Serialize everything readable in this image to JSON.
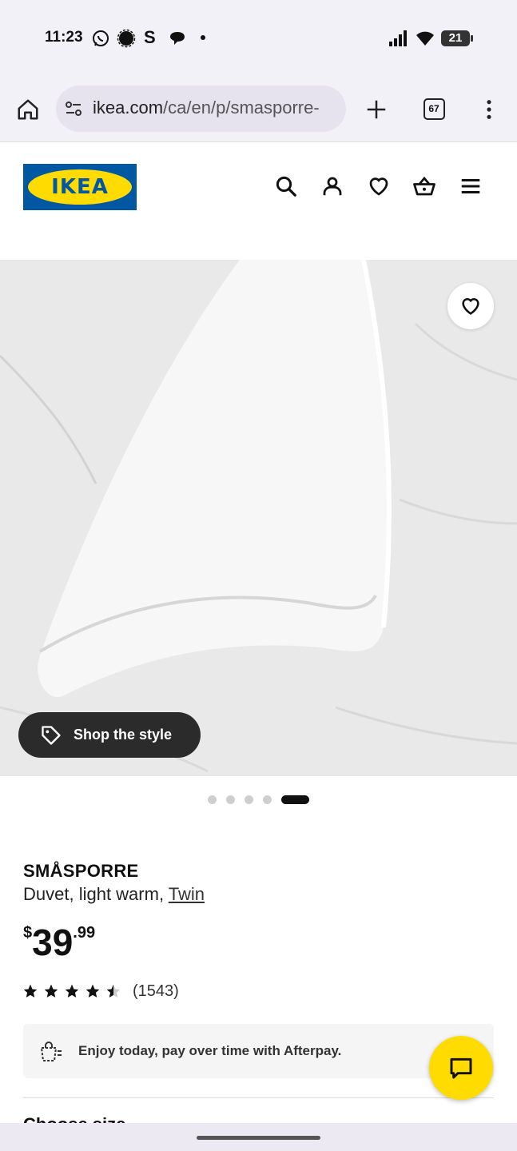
{
  "status_bar": {
    "time": "11:23",
    "battery": "21",
    "icons": [
      "whatsapp-icon",
      "signal-app-icon",
      "s-app-icon",
      "chat-bubble-icon",
      "dot-icon",
      "cell-signal-icon",
      "wifi-icon",
      "battery-icon"
    ]
  },
  "browser": {
    "url_domain": "ikea.com",
    "url_path": "/ca/en/p/smasporre-",
    "tab_count": "67"
  },
  "header": {
    "logo_text": "IKEA",
    "icons": [
      "search-icon",
      "account-icon",
      "favourites-icon",
      "basket-icon",
      "menu-icon"
    ]
  },
  "product": {
    "shop_style_label": "Shop the style",
    "carousel": {
      "total": 5,
      "active": 5
    },
    "name": "SMÅSPORRE",
    "description": "Duvet, light warm, ",
    "size_link": "Twin",
    "price_currency": "$",
    "price_int": "39",
    "price_dec": ".99",
    "rating": 4.5,
    "rating_count": "(1543)",
    "afterpay_text": "Enjoy today, pay over time with Afterpay.",
    "next_section": "Choose size"
  },
  "colors": {
    "ikea_blue": "#0058a3",
    "ikea_yellow": "#ffdb00",
    "browser_bg": "#f3f1f8"
  }
}
